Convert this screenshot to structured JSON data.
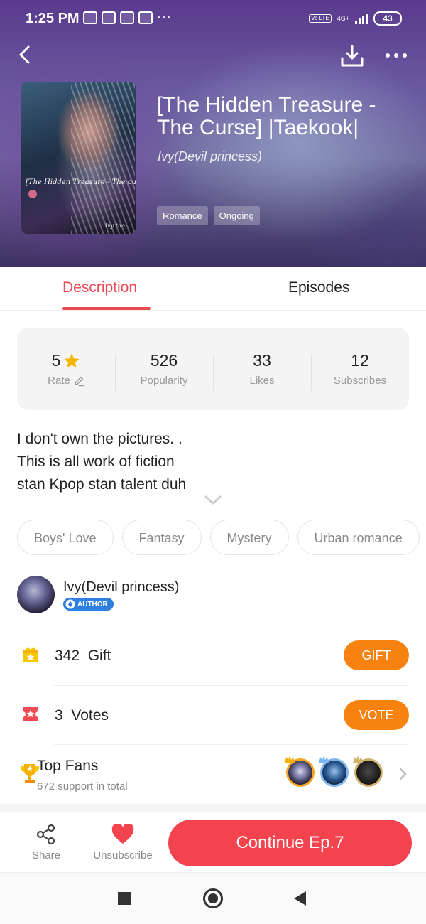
{
  "status_bar": {
    "time": "1:25 PM",
    "network": "4G+",
    "volte": "Vo LTE",
    "battery": "43"
  },
  "book": {
    "title": "[The Hidden Treasure - The Curse] |Taekook|",
    "author": "Ivy(Devil princess)",
    "tags": [
      "Romance",
      "Ongoing"
    ],
    "cover_text": "[The Hidden Treasure - The curse]",
    "cover_signature": "Ivy tho"
  },
  "tabs": {
    "description": "Description",
    "episodes": "Episodes",
    "active": "Description"
  },
  "stats": {
    "rate": {
      "value": "5",
      "label": "Rate"
    },
    "popularity": {
      "value": "526",
      "label": "Popularity"
    },
    "likes": {
      "value": "33",
      "label": "Likes"
    },
    "subscribes": {
      "value": "12",
      "label": "Subscribes"
    }
  },
  "description_lines": [
    "I don't own the pictures. .",
    "This is all work of fiction",
    "stan Kpop stan talent duh"
  ],
  "genres": [
    "Boys' Love",
    "Fantasy",
    "Mystery",
    "Urban romance"
  ],
  "author_section": {
    "name": "Ivy(Devil princess)",
    "badge": "AUTHOR"
  },
  "gift": {
    "count": "342",
    "label": "Gift",
    "button": "GIFT"
  },
  "votes": {
    "count": "3",
    "label": "Votes",
    "button": "VOTE"
  },
  "top_fans": {
    "title": "Top Fans",
    "subtitle": "672 support in total"
  },
  "bottom_bar": {
    "share": "Share",
    "unsubscribe": "Unsubscribe",
    "continue": "Continue Ep.7"
  },
  "colors": {
    "accent": "#e84b55",
    "button_orange": "#f7820f",
    "continue_red": "#f2434f",
    "star": "#f5b400"
  },
  "icons": [
    "back-arrow-icon",
    "download-icon",
    "more-icon",
    "star-icon",
    "edit-icon",
    "chevron-down-icon",
    "gift-icon",
    "vote-ticket-icon",
    "trophy-icon",
    "share-icon",
    "heart-icon",
    "nav-recents-icon",
    "nav-home-icon",
    "nav-back-icon"
  ]
}
